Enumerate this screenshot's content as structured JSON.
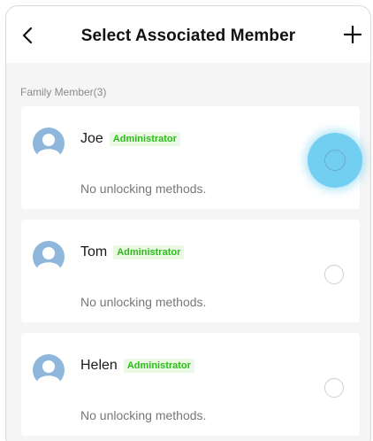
{
  "header": {
    "title": "Select Associated Member",
    "back_icon": "chevron-left-icon",
    "add_icon": "plus-icon"
  },
  "section": {
    "label": "Family Member(3)"
  },
  "members": [
    {
      "name": "Joe",
      "role": "Administrator",
      "status": "No unlocking methods.",
      "selected": false
    },
    {
      "name": "Tom",
      "role": "Administrator",
      "status": "No unlocking methods.",
      "selected": false
    },
    {
      "name": "Helen",
      "role": "Administrator",
      "status": "No unlocking methods.",
      "selected": false
    }
  ],
  "colors": {
    "badge_text": "#2dbb1a",
    "badge_bg": "#eaf9e4",
    "avatar": "#8fb6db",
    "touch_indicator": "#5ec8f0"
  }
}
